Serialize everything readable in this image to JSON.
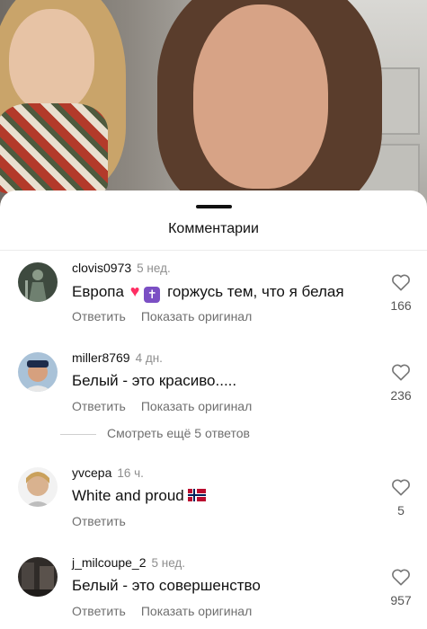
{
  "sheet": {
    "title": "Комментарии"
  },
  "comments": [
    {
      "username": "clovis0973",
      "time": "5 нед.",
      "text_before": "Европа",
      "text_after": "горжусь тем, что я белая",
      "reply_label": "Ответить",
      "translate_label": "Показать оригинал",
      "likes": "166"
    },
    {
      "username": "miller8769",
      "time": "4 дн.",
      "text": "Белый - это красиво.....",
      "reply_label": "Ответить",
      "translate_label": "Показать оригинал",
      "likes": "236"
    },
    {
      "username": "yvcepa",
      "time": "16 ч.",
      "text": "White and proud",
      "reply_label": "Ответить",
      "likes": "5"
    },
    {
      "username": "j_milcoupe_2",
      "time": "5 нед.",
      "text": "Белый - это совершенство",
      "reply_label": "Ответить",
      "translate_label": "Показать оригинал",
      "likes": "957"
    }
  ],
  "more_replies": {
    "label": "Смотреть ещё 5 ответов"
  },
  "icons": {
    "like": "heart-outline-icon",
    "emoji_heart": "red-heart-emoji",
    "emoji_cross": "latin-cross-emoji",
    "flag": "norway-flag-emoji"
  },
  "colors": {
    "secondary_text": "#8e8e8e",
    "action_text": "#6f6f6f",
    "sheet_bg": "#ffffff"
  }
}
